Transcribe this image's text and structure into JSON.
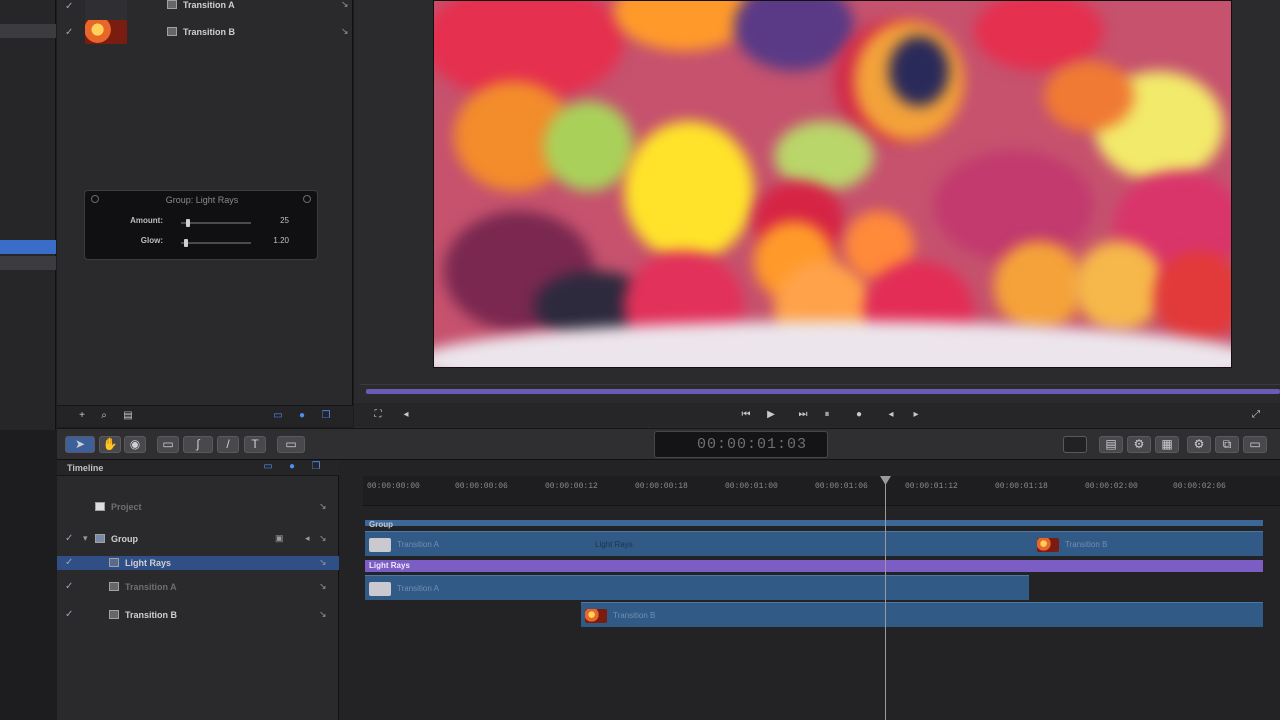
{
  "layers_panel": {
    "rows": [
      {
        "label": "Transition A",
        "thumbnail": false,
        "checked": true
      },
      {
        "label": "Transition B",
        "thumbnail": true,
        "checked": true
      }
    ]
  },
  "hud": {
    "title": "Group: Light Rays",
    "params": [
      {
        "label": "Amount:",
        "value": "25",
        "level": 0.08
      },
      {
        "label": "Glow:",
        "value": "1.20",
        "level": 0.05
      }
    ]
  },
  "viewer": {
    "timecode": "00:00:01:03"
  },
  "toolbar": {
    "text_tool": "T"
  },
  "timeline": {
    "title": "Timeline",
    "layers": [
      {
        "label": "Project",
        "indent": 0,
        "selected": false
      },
      {
        "label": "Group",
        "indent": 0,
        "selected": false
      },
      {
        "label": "Light Rays",
        "indent": 1,
        "selected": true
      },
      {
        "label": "Transition A",
        "indent": 1,
        "selected": false
      },
      {
        "label": "Transition B",
        "indent": 1,
        "selected": false
      }
    ],
    "ruler_labels": [
      "00:00:00:00",
      "00:00:00:06",
      "00:00:00:12",
      "00:00:00:18",
      "00:00:01:00",
      "00:00:01:06",
      "00:00:01:12",
      "00:00:01:18",
      "00:00:02:00",
      "00:00:02:06"
    ],
    "group_label": "Group",
    "light_rays_label": "Light Rays",
    "clips": {
      "group_a": "Transition A",
      "group_b": "Transition B",
      "middle": "Light Rays",
      "track_a": "Transition A",
      "track_b": "Transition B"
    }
  },
  "colors": {
    "accent": "#3a6cc9",
    "clip": "#315a86",
    "filter_bar": "#7b5dc3"
  }
}
